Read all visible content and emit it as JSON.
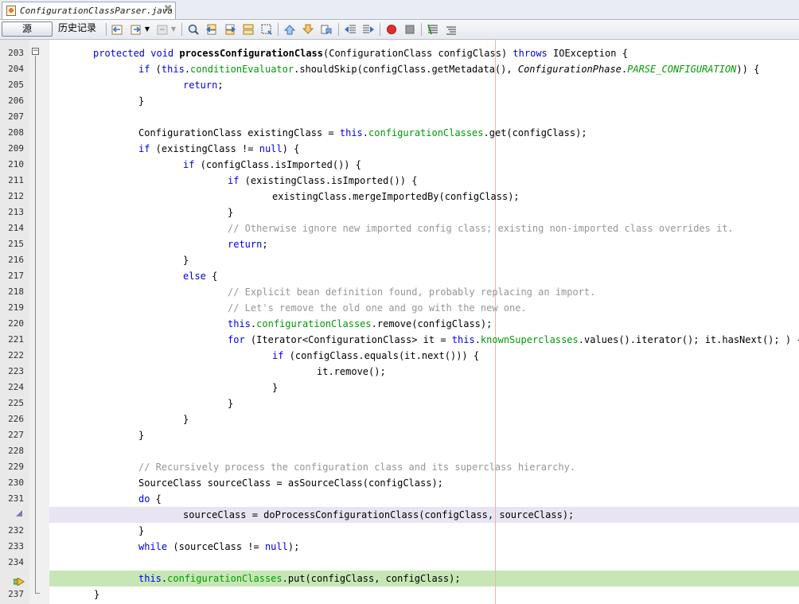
{
  "tab": {
    "title": "ConfigurationClassParser.java",
    "close": "⌘"
  },
  "toolbar": {
    "source_label": "源",
    "history_label": "历史记录",
    "icons": [
      "back-icon",
      "forward-dropdown-icon",
      "disabled-nav-icon",
      "find-icon",
      "find-prev-icon",
      "find-next-icon",
      "toggle-highlight-icon",
      "find-selection-icon",
      "prev-bookmark-icon",
      "next-bookmark-icon",
      "toggle-bookmark-icon",
      "shift-left-icon",
      "shift-right-icon",
      "start-macro-icon",
      "stop-macro-icon",
      "comment-icon",
      "uncomment-icon"
    ]
  },
  "gutter": {
    "line_numbers": [
      "203",
      "204",
      "205",
      "206",
      "207",
      "208",
      "209",
      "210",
      "211",
      "212",
      "213",
      "214",
      "215",
      "216",
      "217",
      "218",
      "219",
      "220",
      "221",
      "222",
      "223",
      "224",
      "225",
      "226",
      "227",
      "228",
      "229",
      "230",
      "231",
      "232",
      "233",
      "234",
      "235",
      "236",
      "237"
    ],
    "hidden_line_numbers": [
      "232",
      "236"
    ]
  },
  "code": {
    "l203": {
      "mod": "protected void ",
      "name": "processConfigurationClass",
      "rest": "(ConfigurationClass configClass) ",
      "throws": "throws",
      "tail": " IOException {"
    },
    "l204": {
      "if": "if",
      "a": " (",
      "this": "this",
      "dot": ".",
      "f": "conditionEvaluator",
      "b": ".shouldSkip(configClass.getMetadata(), ",
      "cls": "ConfigurationPhase",
      "dot2": ".",
      "c": "PARSE_CONFIGURATION",
      "d": ")) {"
    },
    "l205": {
      "kw": "return",
      "p": ";"
    },
    "l206": {
      "t": "}"
    },
    "l208": {
      "a": "ConfigurationClass existingClass = ",
      "this": "this",
      "dot": ".",
      "f": "configurationClasses",
      "b": ".get(configClass);"
    },
    "l209": {
      "if": "if",
      "a": " (existingClass != ",
      "null": "null",
      "b": ") {"
    },
    "l210": {
      "if": "if",
      "a": " (configClass.isImported()) {"
    },
    "l211": {
      "if": "if",
      "a": " (existingClass.isImported()) {"
    },
    "l212": {
      "t": "existingClass.mergeImportedBy(configClass);"
    },
    "l213": {
      "t": "}"
    },
    "l214": {
      "t": "// Otherwise ignore new imported config class; existing non-imported class overrides it."
    },
    "l215": {
      "kw": "return",
      "p": ";"
    },
    "l216": {
      "t": "}"
    },
    "l217": {
      "kw": "else",
      "p": " {"
    },
    "l218": {
      "t": "// Explicit bean definition found, probably replacing an import."
    },
    "l219": {
      "t": "// Let's remove the old one and go with the new one."
    },
    "l220": {
      "this": "this",
      "dot": ".",
      "f": "configurationClasses",
      "b": ".remove(configClass);"
    },
    "l221": {
      "for": "for",
      "a": " (Iterator<ConfigurationClass> it = ",
      "this": "this",
      "dot": ".",
      "f": "knownSuperclasses",
      "b": ".values().iterator(); it.hasNext(); ) {"
    },
    "l222": {
      "if": "if",
      "a": " (configClass.equals(it.next())) {"
    },
    "l223": {
      "t": "it.remove();"
    },
    "l224": {
      "t": "}"
    },
    "l225": {
      "t": "}"
    },
    "l226": {
      "t": "}"
    },
    "l227": {
      "t": "}"
    },
    "l229": {
      "t": "// Recursively process the configuration class and its superclass hierarchy."
    },
    "l230": {
      "t": "SourceClass sourceClass = asSourceClass(configClass);"
    },
    "l231": {
      "kw": "do",
      "p": " {"
    },
    "l232": {
      "t": "sourceClass = doProcessConfigurationClass(configClass, sourceClass);"
    },
    "l233": {
      "t": "}"
    },
    "l234": {
      "kw": "while",
      "a": " (sourceClass != ",
      "null": "null",
      "b": ");"
    },
    "l236": {
      "this": "this",
      "dot": ".",
      "f": "configurationClasses",
      "b": ".put(configClass, configClass);"
    },
    "l237": {
      "t": "}"
    }
  },
  "colors": {
    "keyword": "#0000e6",
    "field": "#009900",
    "comment": "#969696",
    "current_line": "#c6e7b5",
    "highlight_line": "#e9e4f2"
  }
}
